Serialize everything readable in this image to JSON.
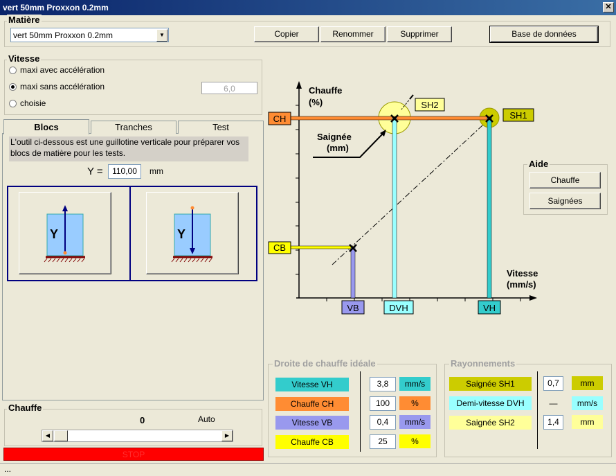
{
  "window": {
    "title": "vert 50mm Proxxon 0.2mm",
    "close": "✕"
  },
  "matiere": {
    "label": "Matière",
    "selected": "vert 50mm Proxxon 0.2mm",
    "copy": "Copier",
    "rename": "Renommer",
    "delete": "Supprimer",
    "database": "Base de données"
  },
  "vitesse": {
    "label": "Vitesse",
    "options": [
      "maxi avec accélération",
      "maxi sans accélération",
      "choisie"
    ],
    "selected_index": 1,
    "value": "6,0"
  },
  "tabs": [
    "Blocs",
    "Tranches",
    "Test"
  ],
  "blocs": {
    "info": "L'outil ci-dessous est une guillotine verticale pour préparer vos blocs de matière pour les tests.",
    "y_label": "Y =",
    "y_value": "110,00",
    "y_unit": "mm",
    "icon_letter": "Y"
  },
  "chauffe": {
    "label": "Chauffe",
    "value": "0",
    "auto": "Auto",
    "stop": "STOP"
  },
  "status": {
    "text": "..."
  },
  "diagram": {
    "y_axis_label1": "Chauffe",
    "y_axis_label2": "(%)",
    "x_axis_label1": "Vitesse",
    "x_axis_label2": "(mm/s)",
    "ch": "CH",
    "cb": "CB",
    "vb": "VB",
    "dvh": "DVH",
    "vh": "VH",
    "sh1": "SH1",
    "sh2": "SH2",
    "saignee1": "Saignée",
    "saignee2": "(mm)"
  },
  "aide": {
    "label": "Aide",
    "chauffe": "Chauffe",
    "saignees": "Saignées"
  },
  "droite": {
    "label": "Droite de chauffe idéale",
    "rows": [
      {
        "name": "Vitesse VH",
        "value": "3,8",
        "unit": "mm/s",
        "color": "#33cccc",
        "ucolor": "#33cccc"
      },
      {
        "name": "Chauffe CH",
        "value": "100",
        "unit": "%",
        "color": "#ff8c33",
        "ucolor": "#ff8c33"
      },
      {
        "name": "Vitesse VB",
        "value": "0,4",
        "unit": "mm/s",
        "color": "#9999ee",
        "ucolor": "#9999ee"
      },
      {
        "name": "Chauffe CB",
        "value": "25",
        "unit": "%",
        "color": "#ffff00",
        "ucolor": "#ffff00"
      }
    ]
  },
  "rayonnements": {
    "label": "Rayonnements",
    "rows": [
      {
        "name": "Saignée SH1",
        "value": "0,7",
        "unit": "mm",
        "color": "#cccc00",
        "ucolor": "#cccc00"
      },
      {
        "name": "Demi-vitesse DVH",
        "value": "—",
        "unit": "mm/s",
        "color": "#99ffff",
        "ucolor": "#99ffff"
      },
      {
        "name": "Saignée SH2",
        "value": "1,4",
        "unit": "mm",
        "color": "#ffff99",
        "ucolor": "#ffff99"
      }
    ]
  }
}
